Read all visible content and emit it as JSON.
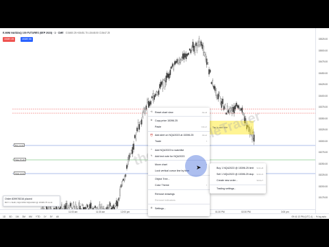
{
  "chart_header": {
    "symbol": "E-MINI NASDAQ 100 FUTURES (SEP 2023) · 1 · CME",
    "ohlc": "O15450.25 H15451.75 L15445.50 C15447.25"
  },
  "order_tags": {
    "sell": "15387.25",
    "buy": "15387.50"
  },
  "price_axis_labels": [
    "15525.00",
    "15500.00",
    "15475.00",
    "15450.00",
    "15425.00",
    "15400.00",
    "15375.00",
    "15350.00",
    "15325.00",
    "15300.00",
    "15275.00",
    "15250.00",
    "15225.00",
    "15200.00",
    "15175.00"
  ],
  "time_axis_labels": [
    "11:00 am",
    "11:30 am",
    "12:00 pm",
    "12:30 pm",
    "1:00 pm",
    "01:30 PM",
    "02:30 PM",
    "3:00 pm"
  ],
  "range_buttons": [
    "1D",
    "5D",
    "1M",
    "3M",
    "6M",
    "YTD",
    "1Y",
    "5Y",
    "All"
  ],
  "clock": "09:41:13 PM (UTC-4)  ⋯  %  log  auto",
  "zone_label": "Tap to add note",
  "hline_labels": [
    "Buy Limit",
    "Take Profit",
    "Stop Loss"
  ],
  "context_menu": {
    "items": [
      {
        "icon": "reset-icon",
        "label": "Reset chart view",
        "shortcut": "Alt+R"
      },
      {
        "icon": "copy-icon",
        "label": "Copy price 15396.25",
        "shortcut": ""
      },
      {
        "icon": "",
        "label": "Paste",
        "shortcut": "Ctrl+V"
      },
      {
        "icon": "alarm-clock-icon",
        "label": "Add alert on NQU2023 at 15396.25",
        "shortcut": "Alt+A"
      },
      {
        "icon": "",
        "label": "Trade",
        "shortcut": ""
      },
      {
        "icon": "plus-icon",
        "label": "Add NQU2023 to watchlist",
        "shortcut": ""
      },
      {
        "icon": "note-icon",
        "label": "Add text note for NQU2023",
        "shortcut": ""
      },
      {
        "icon": "",
        "label": "Move chart",
        "shortcut": ""
      },
      {
        "icon": "",
        "label": "Lock vertical cursor line by time",
        "shortcut": ""
      },
      {
        "icon": "",
        "label": "Object Tree...",
        "shortcut": ""
      },
      {
        "icon": "",
        "label": "Color Theme",
        "shortcut": ""
      },
      {
        "icon": "",
        "label": "Remove drawings",
        "shortcut": ""
      },
      {
        "icon": "",
        "label": "Remove indicators",
        "shortcut": ""
      },
      {
        "icon": "gear-icon",
        "label": "Settings...",
        "shortcut": ""
      }
    ]
  },
  "trade_submenu": {
    "items": [
      {
        "label": "Buy 1 NQU2023 @ 15396.25 limit",
        "shortcut": "Shift+B"
      },
      {
        "label": "Sell 1 NQU2023 @ 15396.25 stop",
        "shortcut": "Shift+S"
      },
      {
        "label": "Create new order...",
        "shortcut": "Shift+T"
      },
      {
        "label": "Trading settings...",
        "shortcut": ""
      }
    ]
  },
  "order_toast": {
    "title": "Order 839978316 placed",
    "detail": "BUY 1 SHR, NQ2 MINI NQU2023 @ 15395.75 Limit"
  },
  "watermark": "theInnerCircleTrader"
}
